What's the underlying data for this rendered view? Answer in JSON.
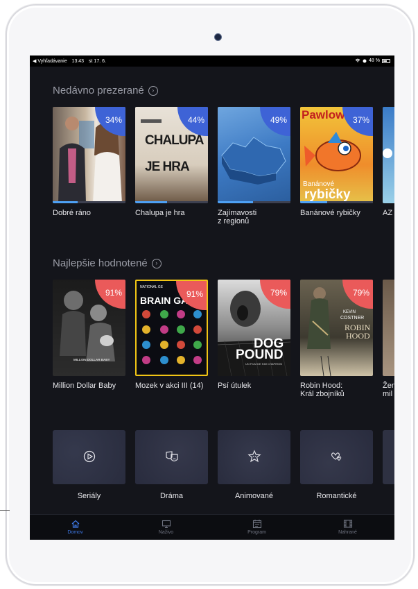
{
  "statusbar": {
    "back_app": "◀ Vyhľadávanie",
    "time": "13:43",
    "date": "st 17. 6.",
    "battery": "48 %"
  },
  "recently_viewed": {
    "title": "Nedávno prezerané",
    "items": [
      {
        "title": "Dobré ráno",
        "percent": "34%",
        "progress": 0.34
      },
      {
        "title": "Chalupa je hra",
        "percent": "44%",
        "progress": 0.44,
        "poster_text_1": "CHALUPA",
        "poster_text_2": "JE HRA"
      },
      {
        "title": "Zajímavosti\nz regionů",
        "percent": "49%",
        "progress": 0.49
      },
      {
        "title": "Banánové rybičky",
        "percent": "37%",
        "progress": 0.37,
        "poster_text_1": "Pawlow",
        "poster_text_2": "Banánové",
        "poster_text_3": "rybičky"
      },
      {
        "title": "AZ"
      }
    ]
  },
  "top_rated": {
    "title": "Najlepšie hodnotené",
    "items": [
      {
        "title": "Million Dollar Baby",
        "percent": "91%",
        "poster_text": "MILLION DOLLAR BABY"
      },
      {
        "title": "Mozek v akci III (14)",
        "percent": "91%",
        "poster_text_1": "NATIONAL GE",
        "poster_text_2": "BRAIN GA"
      },
      {
        "title": "Psí útulek",
        "percent": "79%",
        "poster_text_1": "DOG",
        "poster_text_2": "POUND",
        "poster_text_3": "UN FILM DE KIM CHAPIRON"
      },
      {
        "title": "Robin Hood:\nKrál zbojníků",
        "percent": "79%",
        "poster_text_1": "KEVIN",
        "poster_text_2": "COSTNER",
        "poster_text_3": "ROBIN",
        "poster_text_4": "HOOD"
      },
      {
        "title": "Žen\nmil"
      }
    ]
  },
  "genres": [
    {
      "label": "Seriály",
      "icon": "play-circle-icon"
    },
    {
      "label": "Dráma",
      "icon": "theater-masks-icon"
    },
    {
      "label": "Animované",
      "icon": "star-face-icon"
    },
    {
      "label": "Romantické",
      "icon": "hearts-icon"
    }
  ],
  "tabs": [
    {
      "label": "Domov",
      "icon": "home-icon",
      "active": true
    },
    {
      "label": "Naživo",
      "icon": "tv-icon",
      "active": false
    },
    {
      "label": "Program",
      "icon": "calendar-icon",
      "active": false
    },
    {
      "label": "Nahrané",
      "icon": "film-icon",
      "active": false
    }
  ],
  "colors": {
    "background": "#14151b",
    "accent": "#3f7bea",
    "badge_recent": "#3e63d6",
    "badge_rated": "#ea5a5a",
    "progress": "#4ea1f5"
  }
}
